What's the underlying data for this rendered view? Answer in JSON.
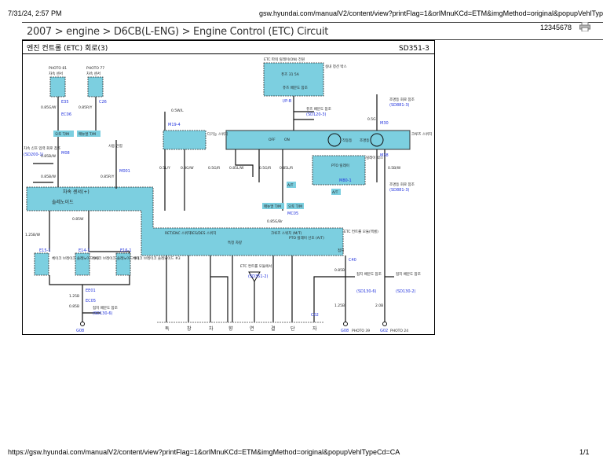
{
  "browser": {
    "date": "7/31/24, 2:57 PM",
    "url": "gsw.hyundai.com/manualV2/content/view?printFlag=1&orlMnuKCd=ETM&imgMethod=original&popupVehlTypeCd=CA",
    "page_code": "12345678"
  },
  "breadcrumb": "2007 > engine > D6CB(L-ENG) > Engine Control (ETC) Circuit",
  "diagram": {
    "title": "엔진 컨트롤 (ETC) 회로(3)",
    "code": "SD351-3",
    "labels": {
      "sensor1": "차속 센서",
      "sensor2": "차속 센서",
      "photo1": "PHOTO 81",
      "photo2": "PHOTO 77",
      "e35": "E35",
      "c26": "C26",
      "ec06": "EC06",
      "m08": "M08",
      "m001": "M001",
      "m19": "M19-4",
      "m30": "M30",
      "m38": "M38",
      "m80": "M80-1",
      "mc05": "MC05",
      "c40": "C40",
      "ip": "I/P-B",
      "c02": "C02",
      "at": "오토 T/M",
      "mt": "매뉴얼 T/M",
      "at2": "A/T",
      "speed_ref": "차속 신호 입력 회로 참조",
      "speed_ref_code": "(SD200-1)",
      "sensor_plus": "차속 센서(+)",
      "solenoid": "솔레노이드",
      "vehicle": "사용 안함",
      "mfs": "다기능 스위치",
      "etc_relay": "ETC 파워 릴레이(ON) 전원",
      "fuse": "퓨즈 31 5A",
      "fuse_ref": "퓨즈 배분도 참조",
      "fuse_ref_code": "(SD120-3)",
      "junction": "실내 정션 박스",
      "off": "OFF",
      "on": "ON",
      "lamp1": "작동등",
      "lamp2": "조명등",
      "cruise": "크루즈 스위치",
      "illum_ref": "조명등 회로 참조",
      "illum_ref_code": "(SD881-3)",
      "pto": "PTO 릴레이",
      "relay_box": "릴레이 박스",
      "ret": "RET/ENC 스위치",
      "res": "RES/DES 스위치",
      "cruise_sw": "크루즈 스위치 (M/T)",
      "pto_sig": "PTO 릴레이 신호 (A/T)",
      "special": "특정 차량",
      "etc_module": "ETC 컨트롤 모듈(엑셀)",
      "ground": "접지",
      "brake1": "체이크 브레이크 솔레노이드 #2",
      "brake2": "체이크 브레이크 솔레노이드 #1",
      "brake3": "체이크 브레이크 솔레노이드 #3",
      "e15": "E15-1",
      "e14": "E14-1",
      "e16": "E16-1",
      "ee01": "EE01",
      "ec05": "EC05",
      "gnd_ref": "접지 배분도 참조",
      "gnd_ref1": "(SD130-6)",
      "gnd_ref2": "(SD130-2)",
      "etc_mod_ref": "ETC 컨트롤 모듈에서",
      "etc_mod_ref_code": "(SD351-2)",
      "g08": "G08",
      "g02": "G02",
      "photo39": "PHOTO 39",
      "photo24": "PHOTO 24",
      "w1": "0.85G/W",
      "w2": "0.85R/Y",
      "w3": "0.85B/W",
      "w4": "0.5W/L",
      "w5": "0.5L/Y",
      "w6": "0.3G/W",
      "w7": "0.5G/R",
      "w8": "0.85L/W",
      "w9": "0.85L/R",
      "w10": "0.5G",
      "w11": "0.5B/W",
      "w12": "0.85B",
      "w13": "1.25B",
      "w14": "2.0B",
      "w15": "0.85W",
      "w16": "1.25B/W",
      "w17": "0.85G/Br"
    },
    "terminal_labels": [
      "독",
      "창",
      "차",
      "향",
      "연",
      "결",
      "단",
      "자"
    ]
  },
  "footer": {
    "url": "https://gsw.hyundai.com/manualV2/content/view?printFlag=1&orlMnuKCd=ETM&imgMethod=original&popupVehlTypeCd=CA",
    "page": "1/1"
  }
}
